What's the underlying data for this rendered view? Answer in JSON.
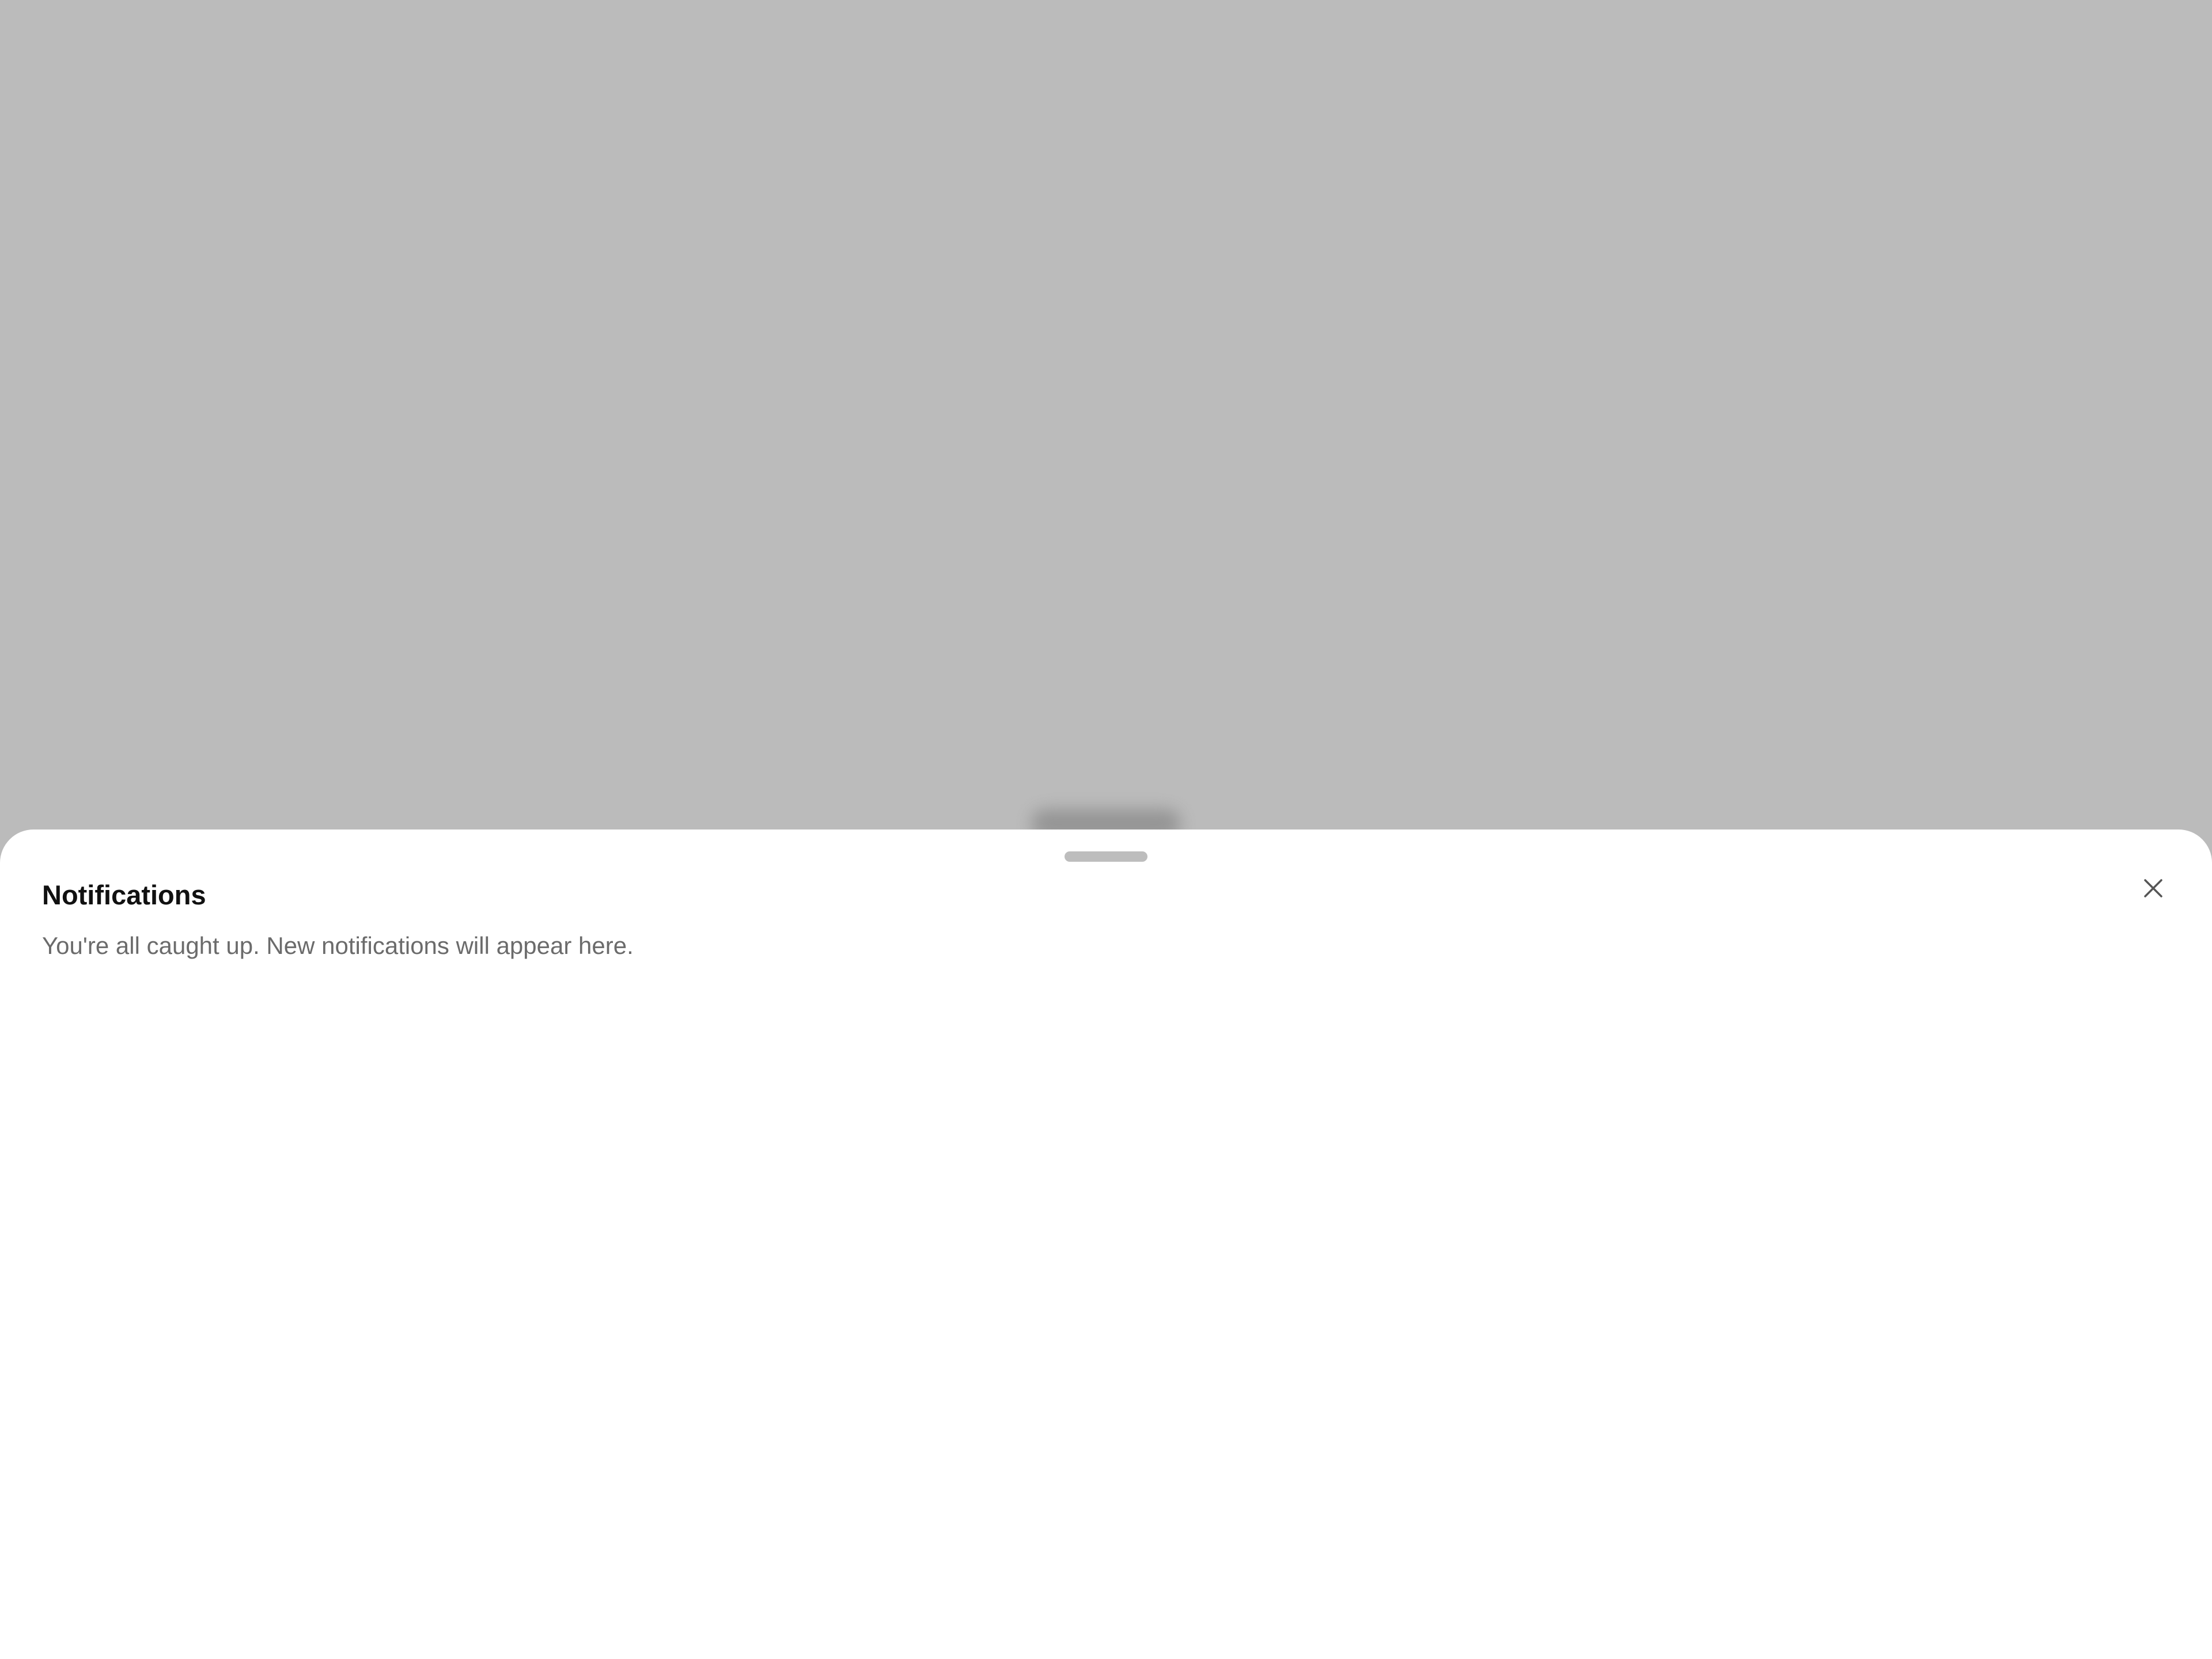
{
  "backdrop": {
    "color": "#bbbbbb"
  },
  "sheet": {
    "title": "Notifications",
    "message": "You're all caught up. New notifications will appear here.",
    "close_icon": "close-icon",
    "background": "#ffffff",
    "grabber_color": "#bdbdbd"
  }
}
